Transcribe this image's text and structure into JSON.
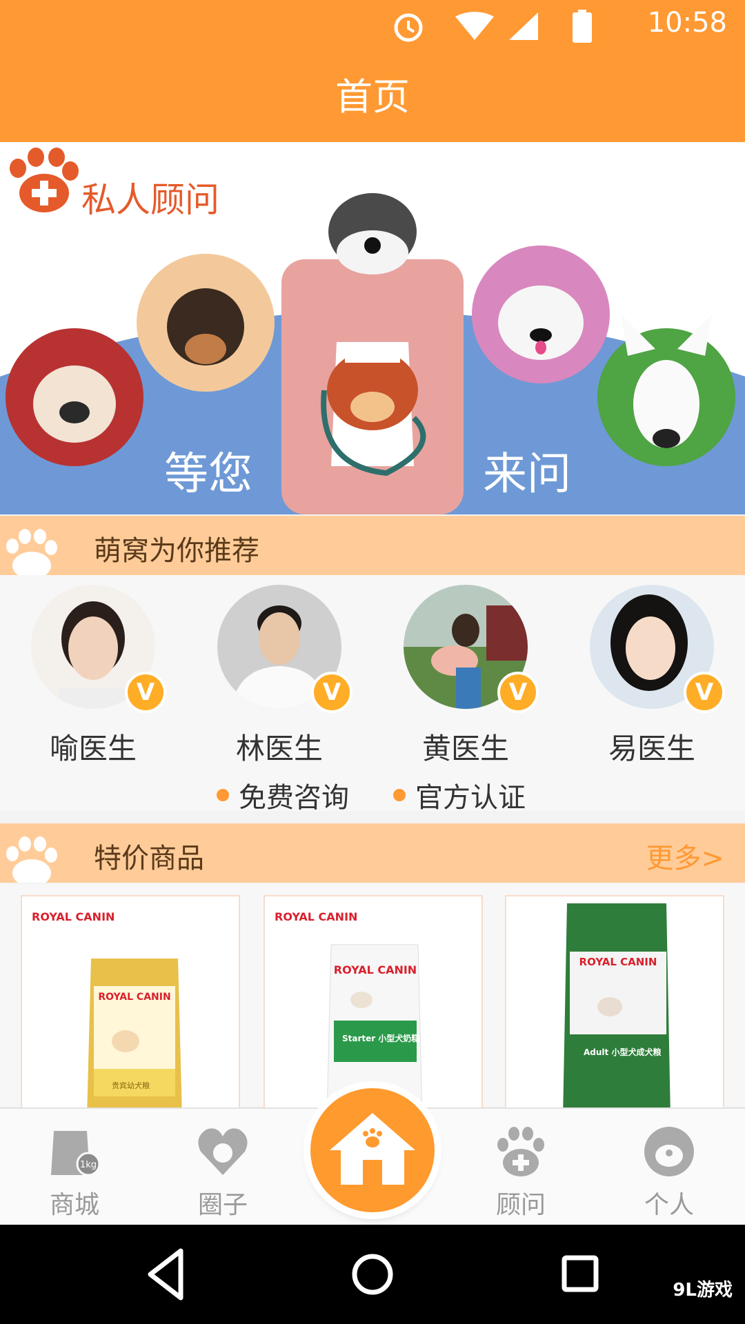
{
  "status_bar": {
    "time": "10:58",
    "battery": "100"
  },
  "header": {
    "title": "首页"
  },
  "banner": {
    "brand": "私人顾问",
    "text_left": "等您",
    "text_right": "来问"
  },
  "recommend": {
    "title": "萌窝为你推荐",
    "doctors": [
      {
        "name": "喻医生",
        "badge": "V"
      },
      {
        "name": "林医生",
        "badge": "V"
      },
      {
        "name": "黄医生",
        "badge": "V"
      },
      {
        "name": "易医生",
        "badge": "V"
      }
    ],
    "features": [
      "免费咨询",
      "官方认证"
    ]
  },
  "deals": {
    "title": "特价商品",
    "more": "更多>",
    "products": [
      {
        "brand": "ROYAL CANIN",
        "package_brand": "ROYAL CANIN",
        "package_text": "贵宾幼犬粮"
      },
      {
        "brand": "ROYAL CANIN",
        "package_brand": "ROYAL CANIN",
        "package_text": "Starter 小型犬奶糕"
      },
      {
        "brand": "",
        "package_brand": "ROYAL CANIN",
        "package_text": "Adult 小型犬成犬粮"
      }
    ]
  },
  "bottom_nav": {
    "items": [
      {
        "label": "商城",
        "icon": "food-bag-icon"
      },
      {
        "label": "圈子",
        "icon": "heart-dog-icon"
      },
      {
        "label": "",
        "icon": "home-icon"
      },
      {
        "label": "顾问",
        "icon": "paw-medical-icon"
      },
      {
        "label": "个人",
        "icon": "dog-face-icon"
      }
    ]
  },
  "watermark": "9L游戏",
  "colors": {
    "primary": "#ff9933",
    "section_bg": "#ffcc99",
    "badge": "#ffad26"
  }
}
